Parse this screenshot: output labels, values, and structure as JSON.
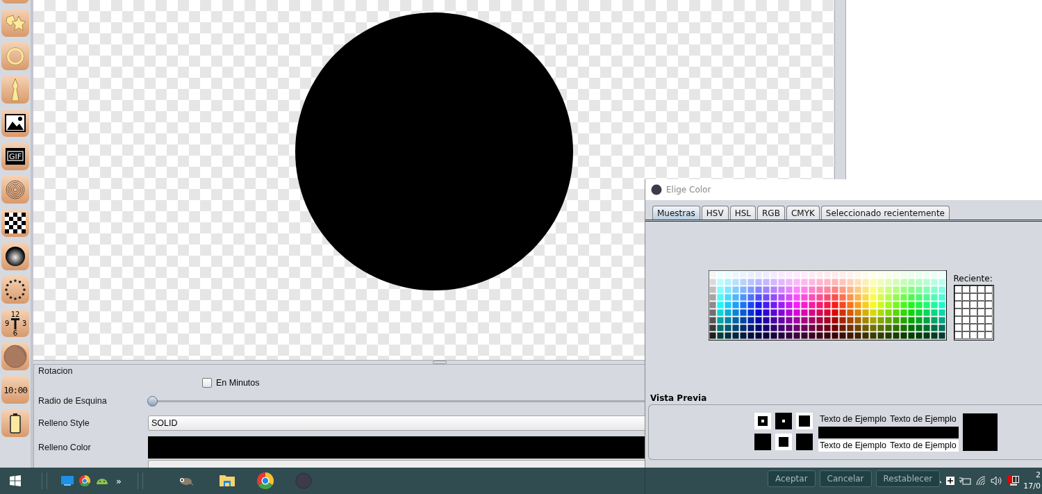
{
  "toolbar": {
    "tools": [
      {
        "kind": "top"
      },
      {
        "kind": "stars"
      },
      {
        "kind": "ring"
      },
      {
        "kind": "pin"
      },
      {
        "kind": "image"
      },
      {
        "kind": "gif",
        "label": "GIF"
      },
      {
        "kind": "spiral"
      },
      {
        "kind": "checker"
      },
      {
        "kind": "sphere"
      },
      {
        "kind": "dots"
      },
      {
        "kind": "clock",
        "labels": [
          "12",
          "9",
          "3",
          "6"
        ]
      },
      {
        "kind": "gauge"
      },
      {
        "kind": "digital",
        "label": "10:00"
      },
      {
        "kind": "battery"
      }
    ]
  },
  "properties": {
    "rows": [
      {
        "kind": "label",
        "label": "Rotacion"
      },
      {
        "kind": "checkbox",
        "label": "En Minutos",
        "checked": false
      },
      {
        "kind": "slider",
        "label": "Radio de Esquina",
        "level": 0
      },
      {
        "kind": "dropdown",
        "label": "Relleno Style",
        "value": "SOLID"
      },
      {
        "kind": "color",
        "label": "Relleno Color"
      },
      {
        "kind": "field"
      }
    ]
  },
  "dialog": {
    "title": "Elige Color",
    "tabs": [
      {
        "label": "Muestras",
        "selected": true
      },
      {
        "label": "HSV",
        "selected": false
      },
      {
        "label": "HSL",
        "selected": false
      },
      {
        "label": "RGB",
        "selected": false
      },
      {
        "label": "CMYK",
        "selected": false
      },
      {
        "label": "Seleccionado recientemente",
        "selected": false
      }
    ],
    "recent_label": "Reciente:",
    "preview_title": "Vista Previa",
    "samples": [
      "Texto de Ejemplo",
      "Texto de Ejemplo",
      "Texto de Ejemplo",
      "Texto de Ejemplo"
    ],
    "buttons": [
      "Aceptar",
      "Cancelar",
      "Restablecer"
    ]
  },
  "taskbar": {
    "items": [
      {
        "kind": "start"
      },
      {
        "kind": "sep"
      },
      {
        "kind": "monitor"
      },
      {
        "kind": "chrome"
      },
      {
        "kind": "android"
      },
      {
        "kind": "more",
        "label": "»"
      },
      {
        "kind": "sep"
      },
      {
        "kind": "gimp"
      },
      {
        "kind": "folder"
      },
      {
        "kind": "chrome"
      },
      {
        "kind": "app"
      }
    ],
    "tray": [
      {
        "kind": "chevron"
      },
      {
        "kind": "plus"
      },
      {
        "kind": "power"
      },
      {
        "kind": "wifi"
      },
      {
        "kind": "speaker"
      },
      {
        "kind": "flag"
      }
    ],
    "clock": [
      "2",
      "17/0"
    ]
  }
}
